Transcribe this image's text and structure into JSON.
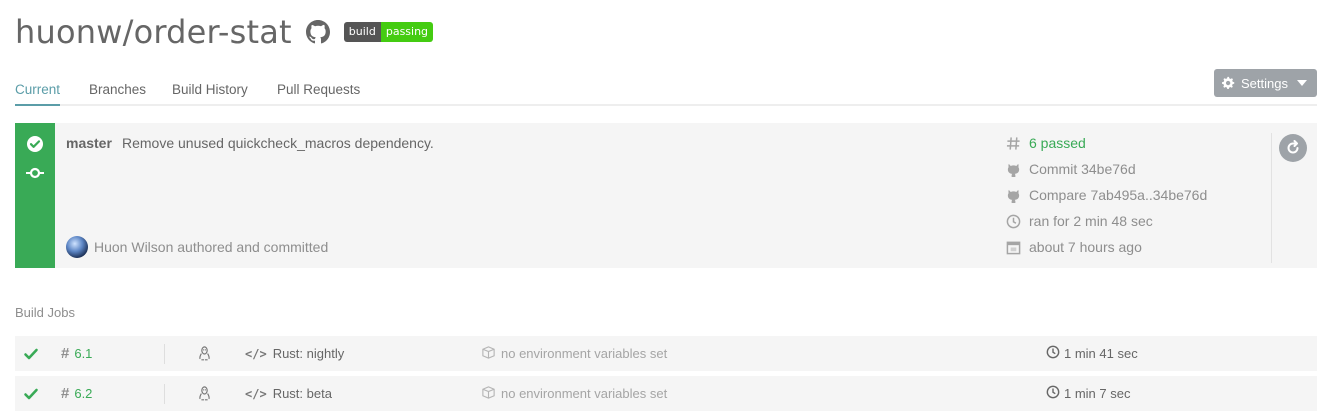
{
  "repo": {
    "title": "huonw/order-stat",
    "github_icon": "github-icon",
    "badge": {
      "left": "build",
      "right": "passing",
      "left_color": "#555555",
      "right_color": "#44cc11"
    }
  },
  "tabs": [
    {
      "label": "Current",
      "active": true
    },
    {
      "label": "Branches",
      "active": false
    },
    {
      "label": "Build History",
      "active": false
    },
    {
      "label": "Pull Requests",
      "active": false
    }
  ],
  "settings": {
    "label": "Settings",
    "icon": "gear-icon"
  },
  "build": {
    "status_color": "#39aa56",
    "branch": "master",
    "message": "Remove unused quickcheck_macros dependency.",
    "author_text": "Huon Wilson authored and committed",
    "meta": {
      "passed": "6 passed",
      "commit": "Commit 34be76d",
      "compare": "Compare 7ab495a..34be76d",
      "duration": "ran for 2 min 48 sec",
      "finished": "about 7 hours ago"
    }
  },
  "jobs_title": "Build Jobs",
  "jobs": [
    {
      "number": "6.1",
      "language": "Rust: nightly",
      "env": "no environment variables set",
      "time": "1 min 41 sec"
    },
    {
      "number": "6.2",
      "language": "Rust: beta",
      "env": "no environment variables set",
      "time": "1 min 7 sec"
    }
  ]
}
